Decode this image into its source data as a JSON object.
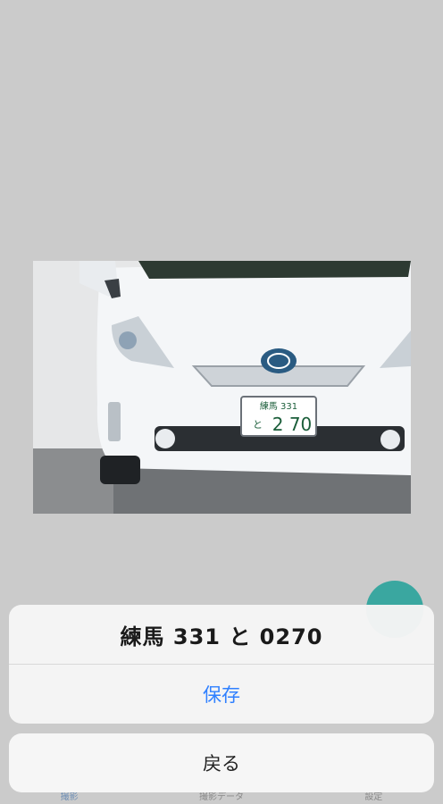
{
  "dialog": {
    "plate_text": "練馬 331 と 0270",
    "save_label": "保存",
    "cancel_label": "戻る"
  },
  "photo": {
    "plate_line1": "練馬 331",
    "plate_line2_left": "と",
    "plate_line2_right": "2 70"
  },
  "tabbar": {
    "items": [
      "撮影",
      "撮影データ",
      "設定"
    ]
  },
  "colors": {
    "accent_blue": "#2f80ff",
    "fab_teal": "#3aa7a0"
  }
}
